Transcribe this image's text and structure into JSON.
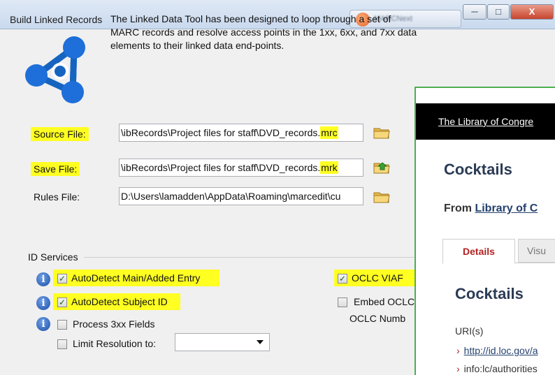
{
  "window": {
    "title": "Build Linked Records",
    "task_label": "MARCNext",
    "minimize_glyph": "─",
    "maximize_glyph": "□",
    "close_glyph": "X"
  },
  "description": "The Linked Data Tool has been designed to loop through a set of MARC records and resolve access points in the 1xx, 6xx, and 7xx data elements to their linked data end-points.",
  "files": {
    "source": {
      "label": "Source File:",
      "value_prefix": "\\ibRecords\\Project files for staff\\DVD_records.",
      "value_ext": "mrc"
    },
    "save": {
      "label": "Save File:",
      "value_prefix": "\\ibRecords\\Project files for staff\\DVD_records.",
      "value_ext": "mrk"
    },
    "rules": {
      "label": "Rules File:",
      "value": "D:\\Users\\lamadden\\AppData\\Roaming\\marcedit\\cu"
    }
  },
  "services": {
    "group_label": "ID Services",
    "options": {
      "autodetect_main": {
        "label": "AutoDetect Main/Added Entry",
        "checked": true
      },
      "autodetect_subject": {
        "label": "AutoDetect Subject ID",
        "checked": true
      },
      "process_3xx": {
        "label": "Process 3xx Fields",
        "checked": false
      },
      "limit_resolution": {
        "label": "Limit Resolution to:",
        "checked": false,
        "selected": ""
      },
      "oclc_viaf": {
        "label": "OCLC VIAF",
        "checked": true
      },
      "embed_oclc": {
        "label": "Embed OCLC",
        "checked": false
      },
      "oclc_number_label": "OCLC Numb"
    },
    "check_glyph": "✓"
  },
  "browser": {
    "banner_link": "The Library of Congre",
    "heading": "Cocktails",
    "from_prefix": "From ",
    "from_link": "Library of C",
    "tabs": [
      "Details",
      "Visu"
    ],
    "subheading": "Cocktails",
    "uri_label": "URI(s)",
    "uri_1": "http://id.loc.gov/a",
    "uri_2": "info:lc/authorities",
    "arrow_glyph": "›"
  },
  "colors": {
    "highlight": "#ffff22",
    "panel_border": "#4caf50",
    "accent_link": "#23406e",
    "tab_active": "#b22222"
  }
}
